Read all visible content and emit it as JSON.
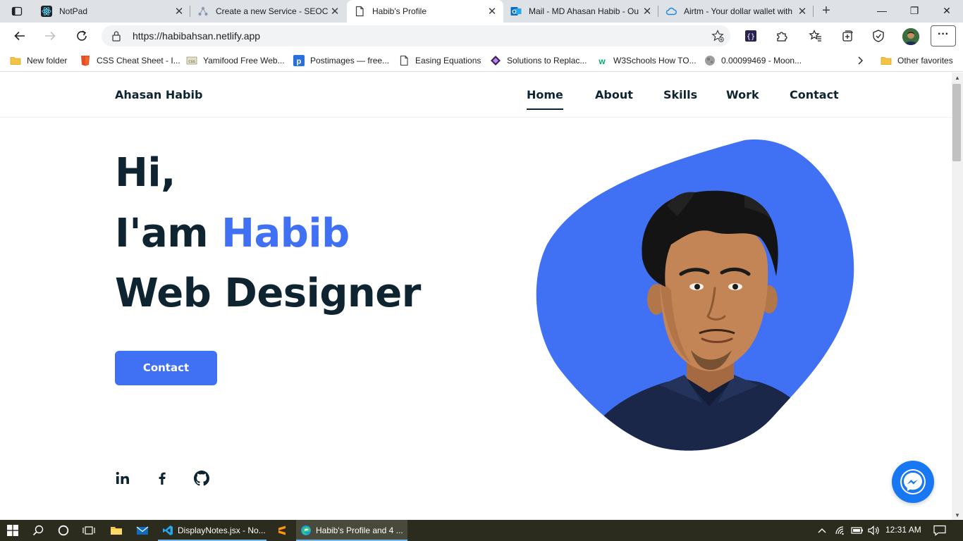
{
  "browser": {
    "tabs": [
      {
        "title": "NotPad",
        "active": false
      },
      {
        "title": "Create a new Service - SEOCl",
        "active": false
      },
      {
        "title": "Habib's Profile",
        "active": true
      },
      {
        "title": "Mail - MD Ahasan Habib - Ou",
        "active": false
      },
      {
        "title": "Airtm - Your dollar wallet with",
        "active": false
      }
    ],
    "url": "https://habibahsan.netlify.app",
    "bookmarks": [
      "New folder",
      "CSS Cheat Sheet - I...",
      "Yamifood Free Web...",
      "Postimages — free...",
      "Easing Equations",
      "Solutions to Replac...",
      "W3Schools How TO...",
      "0.00099469 - Moon..."
    ],
    "other_favorites": "Other favorites",
    "window_controls": {
      "minimize": "—",
      "restore": "❐",
      "close": "✕"
    },
    "new_tab": "+",
    "tab_close": "✕",
    "menu": "···"
  },
  "site": {
    "logo": "Ahasan Habib",
    "nav": [
      "Home",
      "About",
      "Skills",
      "Work",
      "Contact"
    ],
    "hero": {
      "line1": "Hi,",
      "line2_prefix": "I'am ",
      "line2_name": "Habib",
      "line3": "Web Designer"
    },
    "contact_button": "Contact",
    "accent_color": "#4070f4",
    "text_color": "#0e2431"
  },
  "taskbar": {
    "apps": [
      "DisplayNotes.jsx - No...",
      "Habib's Profile and 4 ..."
    ],
    "time": "12:31 AM"
  }
}
